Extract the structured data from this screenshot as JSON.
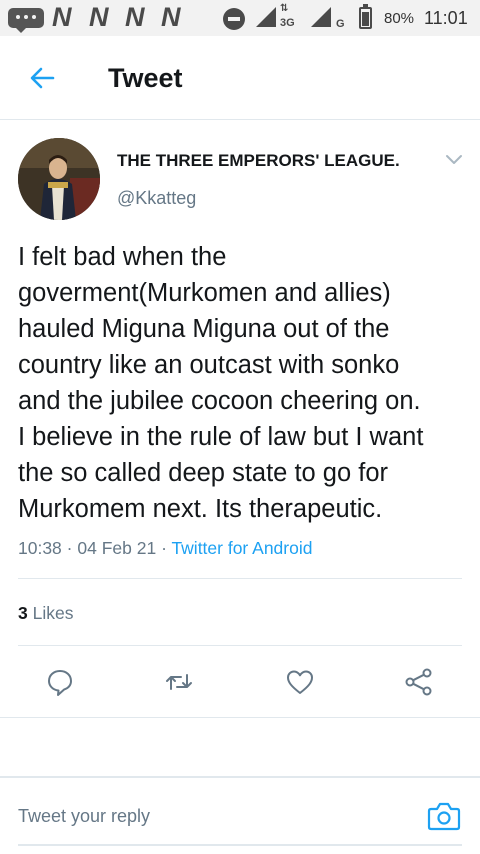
{
  "status_bar": {
    "notification_icons": [
      "message-icon",
      "N",
      "N",
      "N",
      "N"
    ],
    "network_label": "3G",
    "network_label_2": "G",
    "battery_percent": "80%",
    "battery_level": 0.8,
    "time": "11:01"
  },
  "header": {
    "back_icon": "arrow-left-icon",
    "title": "Tweet"
  },
  "tweet": {
    "author_name": "THE THREE EMPERORS' LEAGUE.",
    "handle": "@Kkatteg",
    "text": "I felt bad when the\ngoverment(Murkomen and allies)\nhauled Miguna Miguna out of the\ncountry like an outcast with sonko\nand the jubilee cocoon cheering on.\nI believe in the rule of law but I want\nthe so called deep state to go for\nMurkomem next. Its therapeutic.",
    "time": "10:38",
    "date": "04 Feb 21",
    "separator": "·",
    "source": "Twitter for Android",
    "likes_count": "3",
    "likes_label": "Likes"
  },
  "actions": [
    "reply-icon",
    "retweet-icon",
    "like-icon",
    "share-icon"
  ],
  "reply": {
    "placeholder": "Tweet your reply",
    "camera_icon": "camera-icon"
  },
  "colors": {
    "accent": "#1da1f2",
    "secondary_text": "#657786",
    "divider": "#e1e8ed"
  }
}
